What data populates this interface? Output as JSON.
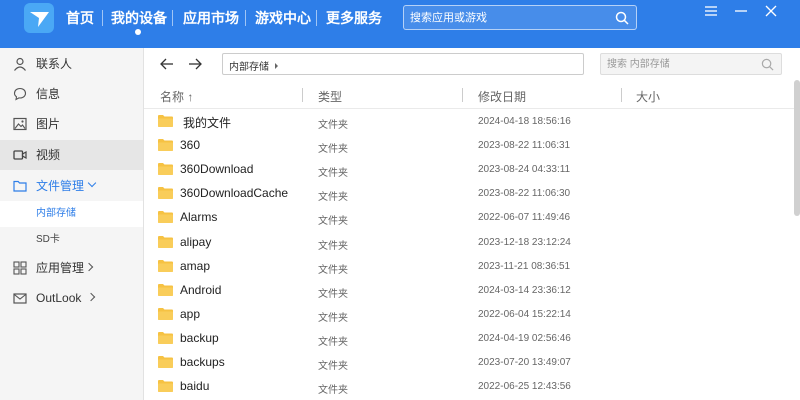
{
  "nav": {
    "items": [
      {
        "label": "首页"
      },
      {
        "label": "我的设备"
      },
      {
        "label": "应用市场"
      },
      {
        "label": "游戏中心"
      },
      {
        "label": "更多服务"
      }
    ],
    "search_placeholder": "搜索应用或游戏"
  },
  "sidebar": {
    "items": [
      {
        "label": "联系人",
        "icon": "person-icon"
      },
      {
        "label": "信息",
        "icon": "message-icon"
      },
      {
        "label": "图片",
        "icon": "image-icon"
      },
      {
        "label": "视频",
        "icon": "video-icon"
      },
      {
        "label": "文件管理",
        "icon": "folder-icon"
      },
      {
        "label": "应用管理",
        "icon": "apps-icon"
      },
      {
        "label": "OutLook",
        "icon": "mail-icon"
      }
    ],
    "subitems": [
      {
        "label": "内部存储"
      },
      {
        "label": "SD卡"
      }
    ]
  },
  "toolbar": {
    "path": "内部存储",
    "search_placeholder": "搜索 内部存储"
  },
  "columns": {
    "name": "名称 ↑",
    "type": "类型",
    "date": "修改日期",
    "size": "大小"
  },
  "files": [
    {
      "name": "我的文件",
      "type": "文件夹",
      "date": "2024-04-18 18:56:16"
    },
    {
      "name": "360",
      "type": "文件夹",
      "date": "2023-08-22 11:06:31"
    },
    {
      "name": "360Download",
      "type": "文件夹",
      "date": "2023-08-24 04:33:11"
    },
    {
      "name": "360DownloadCache",
      "type": "文件夹",
      "date": "2023-08-22 11:06:30"
    },
    {
      "name": "Alarms",
      "type": "文件夹",
      "date": "2022-06-07 11:49:46"
    },
    {
      "name": "alipay",
      "type": "文件夹",
      "date": "2023-12-18 23:12:24"
    },
    {
      "name": "amap",
      "type": "文件夹",
      "date": "2023-11-21 08:36:51"
    },
    {
      "name": "Android",
      "type": "文件夹",
      "date": "2024-03-14 23:36:12"
    },
    {
      "name": "app",
      "type": "文件夹",
      "date": "2022-06-04 15:22:14"
    },
    {
      "name": "backup",
      "type": "文件夹",
      "date": "2024-04-19 02:56:46"
    },
    {
      "name": "backups",
      "type": "文件夹",
      "date": "2023-07-20 13:49:07"
    },
    {
      "name": "baidu",
      "type": "文件夹",
      "date": "2022-06-25 12:43:56"
    }
  ],
  "colors": {
    "accent": "#2e7ee8",
    "folder": "#f6c243"
  }
}
